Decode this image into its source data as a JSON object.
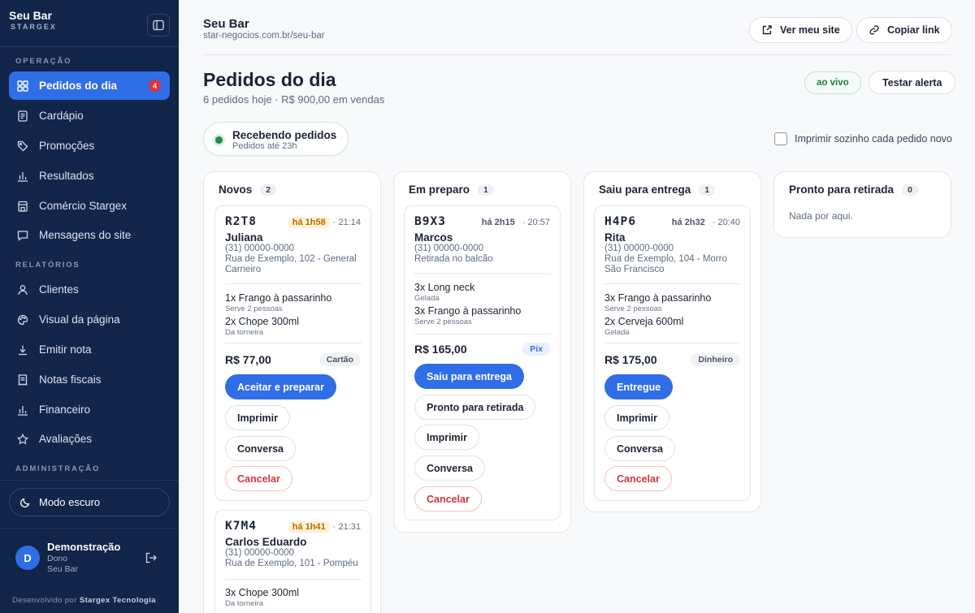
{
  "sidebar": {
    "brand": "Seu Bar",
    "brand_sub": "STARGEX",
    "sections": {
      "operacao": "OPERAÇÃO",
      "relatorios": "RELATÓRIOS",
      "administracao": "ADMINISTRAÇÃO"
    },
    "items": [
      {
        "label": "Pedidos do dia",
        "icon": "grid-icon",
        "badge": "4"
      },
      {
        "label": "Cardápio",
        "icon": "menu-book-icon"
      },
      {
        "label": "Promoções",
        "icon": "tag-icon"
      },
      {
        "label": "Resultados",
        "icon": "bar-chart-icon"
      },
      {
        "label": "Comércio Stargex",
        "icon": "store-icon"
      },
      {
        "label": "Mensagens do site",
        "icon": "message-icon"
      },
      {
        "label": "Clientes",
        "icon": "user-icon"
      },
      {
        "label": "Visual da página",
        "icon": "palette-icon"
      },
      {
        "label": "Emitir nota",
        "icon": "download-icon"
      },
      {
        "label": "Notas fiscais",
        "icon": "receipt-icon"
      },
      {
        "label": "Financeiro",
        "icon": "bar-chart-icon"
      },
      {
        "label": "Avaliações",
        "icon": "star-icon"
      }
    ],
    "dark_mode": "Modo escuro",
    "user": {
      "initial": "D",
      "name": "Demonstração",
      "role": "Dono",
      "shop": "Seu Bar"
    },
    "footer_prefix": "Desenvolvido por",
    "footer_brand": "Stargex Tecnologia"
  },
  "header": {
    "shop_name": "Seu Bar",
    "shop_url": "star-negocios.com.br/seu-bar",
    "view_site": "Ver meu site",
    "copy_link": "Copiar link"
  },
  "page": {
    "title": "Pedidos do dia",
    "subtitle": "6 pedidos hoje · R$ 900,00 em vendas",
    "live": "ao vivo",
    "test_alert": "Testar alerta",
    "receiving_title": "Recebendo pedidos",
    "receiving_sub": "Pedidos até 23h",
    "auto_print": "Imprimir sozinho cada pedido novo"
  },
  "columns": [
    {
      "title": "Novos",
      "count": "2"
    },
    {
      "title": "Em preparo",
      "count": "1"
    },
    {
      "title": "Saiu para entrega",
      "count": "1"
    },
    {
      "title": "Pronto para retirada",
      "count": "0",
      "empty": "Nada por aqui."
    }
  ],
  "orders": {
    "r2t8": {
      "code": "R2T8",
      "age": "há 1h58",
      "time": "· 21:14",
      "name": "Juliana",
      "phone": "(31) 00000-0000",
      "address": "Rua de Exemplo, 102 - General Carneiro",
      "items": [
        {
          "name": "1x Frango à passarinho",
          "note": "Serve 2 pessoas"
        },
        {
          "name": "2x Chope 300ml",
          "note": "Da torneira"
        }
      ],
      "total": "R$ 77,00",
      "payment": "Cartão",
      "actions": {
        "primary": "Aceitar e preparar",
        "print": "Imprimir",
        "chat": "Conversa",
        "cancel": "Cancelar"
      }
    },
    "b9x3": {
      "code": "B9X3",
      "age": "há 2h15",
      "time": "· 20:57",
      "name": "Marcos",
      "phone": "(31) 00000-0000",
      "address": "Retirada no balcão",
      "items": [
        {
          "name": "3x Long neck",
          "note": "Gelada"
        },
        {
          "name": "3x Frango à passarinho",
          "note": "Serve 2 pessoas"
        }
      ],
      "total": "R$ 165,00",
      "payment": "Pix",
      "actions": {
        "primary": "Saiu para entrega",
        "pickup": "Pronto para retirada",
        "print": "Imprimir",
        "chat": "Conversa",
        "cancel": "Cancelar"
      }
    },
    "h4p6": {
      "code": "H4P6",
      "age": "há 2h32",
      "time": "· 20:40",
      "name": "Rita",
      "phone": "(31) 00000-0000",
      "address": "Rua de Exemplo, 104 - Morro São Francisco",
      "items": [
        {
          "name": "3x Frango à passarinho",
          "note": "Serve 2 pessoas"
        },
        {
          "name": "2x Cerveja 600ml",
          "note": "Gelada"
        }
      ],
      "total": "R$ 175,00",
      "payment": "Dinheiro",
      "actions": {
        "primary": "Entregue",
        "print": "Imprimir",
        "chat": "Conversa",
        "cancel": "Cancelar"
      }
    },
    "k7m4": {
      "code": "K7M4",
      "age": "há 1h41",
      "time": "· 21:31",
      "name": "Carlos Eduardo",
      "phone": "(31) 00000-0000",
      "address": "Rua de Exemplo, 101 - Pompéu",
      "items": [
        {
          "name": "3x Chope 300ml",
          "note": "Da torneira"
        }
      ]
    }
  },
  "colors": {
    "sidebar_bg": "#12264a",
    "accent": "#2f6ee6",
    "live_green": "#1f8a4c",
    "danger": "#d3333a",
    "badge": "#e0323d"
  }
}
